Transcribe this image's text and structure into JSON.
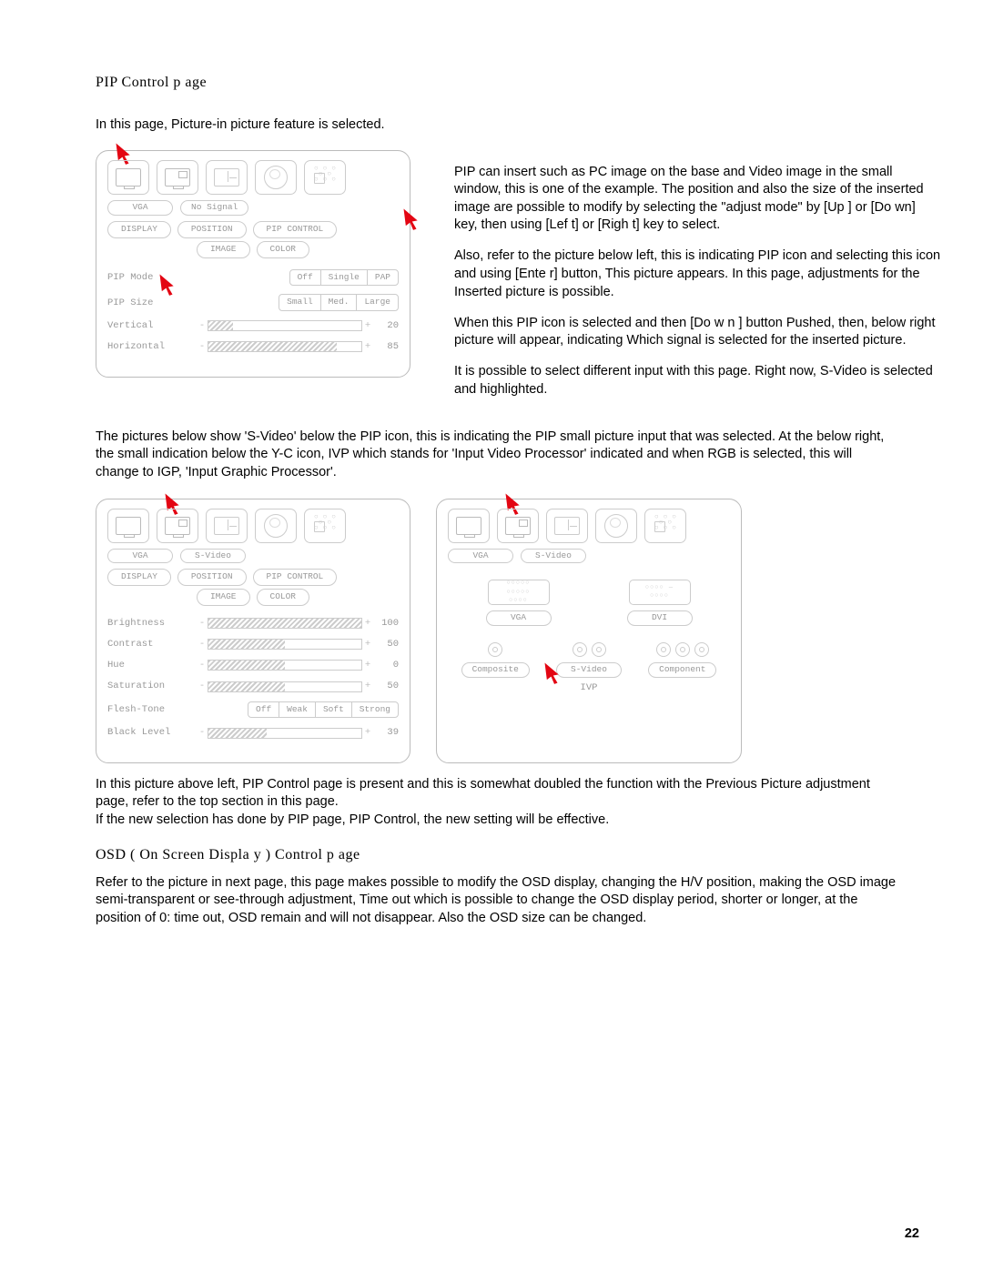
{
  "title": "PIP Control p  age",
  "intro": "In this page, Picture-in picture feature is selected.",
  "side_text": "PIP can insert such as PC image on the base and Video image in the small window, this is one of the example. The position and also the size of the inserted image are possible to modify by selecting the \"adjust mode\" by [Up ] or [Do wn] key, then using [Lef t] or [Righ t] key to select.\nAlso, refer to the picture below left, this is indicating PIP icon and selecting this icon and using [Ente r] button, This picture appears.    In this page, adjustments for the Inserted picture is possible.\nWhen this PIP icon is selected and then [Do w n ] button Pushed, then, below right picture will appear, indicating Which signal is selected for the inserted picture.\nIt is possible to select different input with this page. Right now, S-Video is selected and highlighted.",
  "mid_para": "The pictures below show 'S-Video' below the PIP icon, this is indicating the PIP small picture input that was selected.   At the below right, the small indication below the Y-C icon, IVP which stands for 'Input Video Processor' indicated and when RGB is selected, this will change to IGP, 'Input Graphic Processor'.",
  "bottom_para": "In this picture above left, PIP Control page is present and this is somewhat doubled the function with the Previous Picture adjustment page, refer to the top section in this page.\nIf the new selection has done by PIP page, PIP Control, the new setting will be effective.",
  "h2": "OSD ( On Screen Displa    y ) Control p  age",
  "osd_para": "Refer to the picture in next page, this page makes possible to modify the OSD display, changing the H/V position, making the OSD image semi-transparent or see-through adjustment, Time out which is possible to change the OSD display period, shorter or longer, at the position of 0: time out, OSD remain and will not disappear.   Also the OSD size can be changed.",
  "page_no": "22",
  "panel1": {
    "src1": "VGA",
    "src2": "No Signal",
    "tabs": [
      "DISPLAY",
      "POSITION",
      "PIP CONTROL",
      "IMAGE",
      "COLOR"
    ],
    "r1": {
      "label": "PIP Mode",
      "opts": [
        "Off",
        "Single",
        "PAP"
      ]
    },
    "r2": {
      "label": "PIP Size",
      "opts": [
        "Small",
        "Med.",
        "Large"
      ]
    },
    "r3": {
      "label": "Vertical",
      "val": "20",
      "fill": 16
    },
    "r4": {
      "label": "Horizontal",
      "val": "85",
      "fill": 84
    }
  },
  "panel2": {
    "src1": "VGA",
    "src2": "S-Video",
    "tabs": [
      "DISPLAY",
      "POSITION",
      "PIP CONTROL",
      "IMAGE",
      "COLOR"
    ],
    "rows": [
      {
        "label": "Brightness",
        "val": "100",
        "fill": 100
      },
      {
        "label": "Contrast",
        "val": "50",
        "fill": 50
      },
      {
        "label": "Hue",
        "val": "0",
        "fill": 50
      },
      {
        "label": "Saturation",
        "val": "50",
        "fill": 50
      }
    ],
    "ft": {
      "label": "Flesh-Tone",
      "opts": [
        "Off",
        "Weak",
        "Soft",
        "Strong"
      ]
    },
    "bl": {
      "label": "Black Level",
      "val": "39",
      "fill": 38
    }
  },
  "panel3": {
    "src1": "VGA",
    "src2": "S-Video",
    "ports": [
      "VGA",
      "DVI"
    ],
    "inputs": [
      "Composite",
      "S-Video",
      "Component"
    ],
    "ivp": "IVP"
  }
}
